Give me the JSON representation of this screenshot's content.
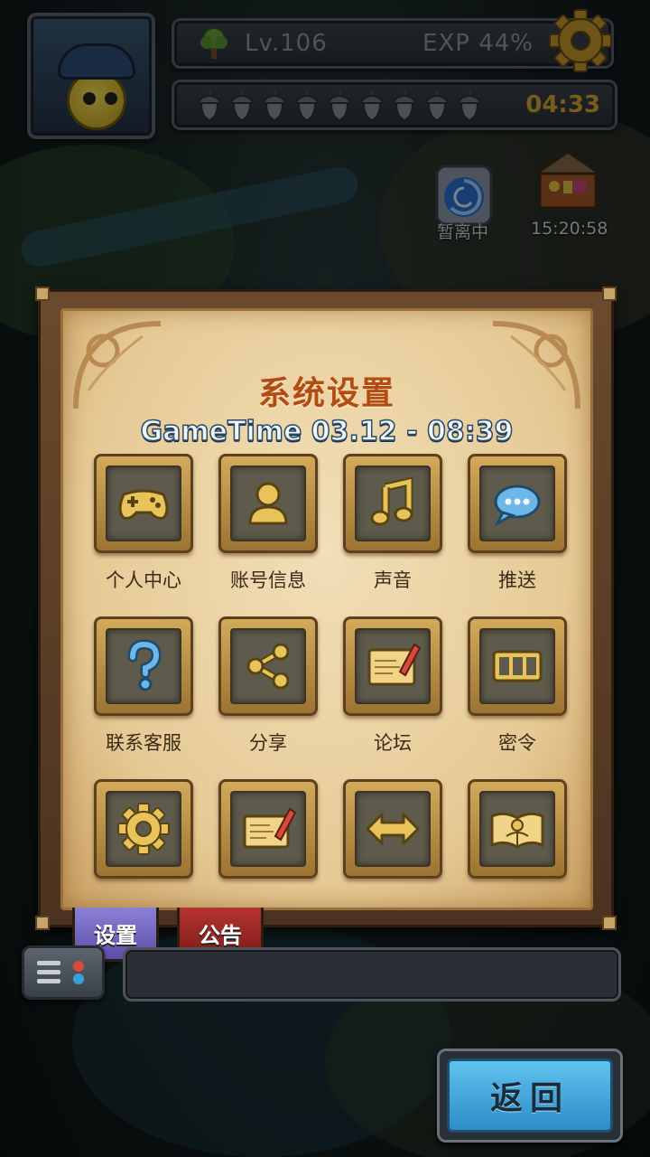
{
  "hud": {
    "level": "Lv.106",
    "exp": "EXP 44%",
    "exp_percent": 44,
    "stamina_count": 9,
    "stamina_timer": "04:33",
    "portal_label": "暂离中",
    "chest_timer": "15:20:58"
  },
  "dialog": {
    "title": "系统设置",
    "game_time": "GameTime 03.12 - 08:39",
    "items": [
      {
        "label": "个人中心",
        "icon": "gamepad-icon"
      },
      {
        "label": "账号信息",
        "icon": "user-icon"
      },
      {
        "label": "声音",
        "icon": "music-note-icon"
      },
      {
        "label": "推送",
        "icon": "chat-bubble-icon"
      },
      {
        "label": "联系客服",
        "icon": "question-mark-icon"
      },
      {
        "label": "分享",
        "icon": "share-icon"
      },
      {
        "label": "论坛",
        "icon": "note-pencil-icon"
      },
      {
        "label": "密令",
        "icon": "code-box-icon"
      },
      {
        "label": "",
        "icon": "gear-icon"
      },
      {
        "label": "",
        "icon": "letter-pencil-icon"
      },
      {
        "label": "",
        "icon": "double-arrow-icon"
      },
      {
        "label": "",
        "icon": "open-book-icon"
      }
    ]
  },
  "tabs": {
    "settings": "设置",
    "notice": "公告"
  },
  "back_button": "返回",
  "colors": {
    "title": "#b34b12",
    "tile_gold": "#d3aa5a",
    "icon_gold": "#e7c35a",
    "back_blue": "#3fa5dc",
    "settings_tab": "#7467c4",
    "notice_tab": "#9e2924"
  }
}
